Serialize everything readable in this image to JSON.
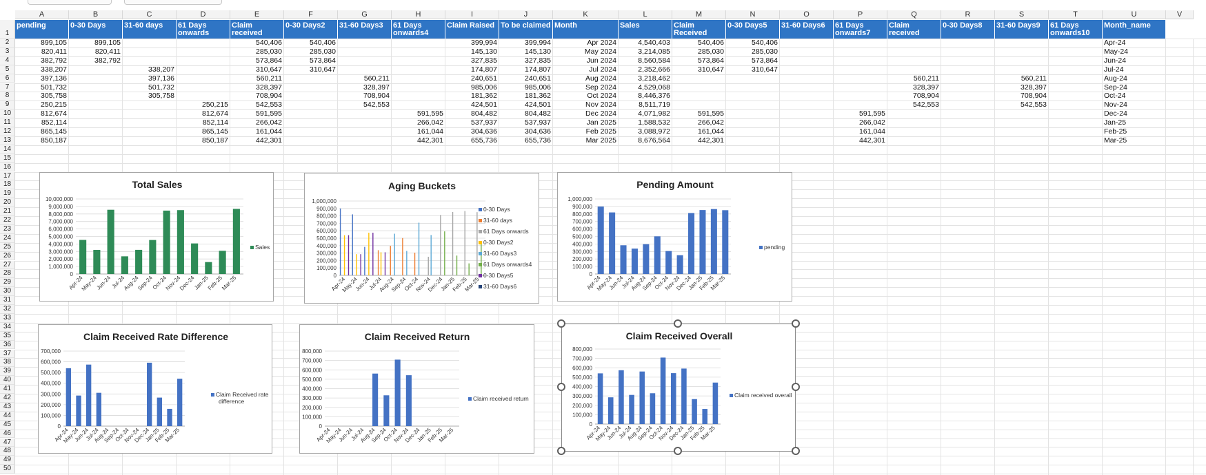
{
  "sheet": {
    "columns": [
      "A",
      "B",
      "C",
      "D",
      "E",
      "F",
      "G",
      "H",
      "I",
      "J",
      "K",
      "L",
      "M",
      "N",
      "O",
      "P",
      "Q",
      "R",
      "S",
      "T",
      "U",
      "V"
    ],
    "row_numbers": [
      "1",
      "2",
      "3",
      "4",
      "5",
      "6",
      "7",
      "8",
      "9",
      "10",
      "11",
      "12",
      "13",
      "14",
      "15",
      "16",
      "17",
      "18",
      "19",
      "20",
      "21",
      "22",
      "23",
      "24",
      "25",
      "26",
      "27",
      "28",
      "29",
      "30",
      "31",
      "32",
      "33",
      "34",
      "35",
      "36",
      "37",
      "38",
      "39",
      "40",
      "41",
      "42",
      "43",
      "44",
      "45",
      "46",
      "47",
      "48",
      "49",
      "50"
    ],
    "headers": [
      "pending",
      "0-30 Days",
      "31-60 days",
      "61 Days onwards",
      "Claim received",
      "0-30 Days2",
      "31-60 Days3",
      "61 Days onwards4",
      "Claim Raised",
      "To be claimed",
      "Month",
      "Sales",
      "Claim Received",
      "0-30 Days5",
      "31-60 Days6",
      "61 Days onwards7",
      "Claim received",
      "0-30 Days8",
      "31-60 Days9",
      "61 Days onwards10",
      "Month_name"
    ],
    "rows": [
      [
        "899,105",
        "899,105",
        "",
        "",
        "540,406",
        "540,406",
        "",
        "",
        "399,994",
        "399,994",
        "Apr 2024",
        "4,540,403",
        "540,406",
        "540,406",
        "",
        "",
        "",
        "",
        "",
        "",
        "Apr-24"
      ],
      [
        "820,411",
        "820,411",
        "",
        "",
        "285,030",
        "285,030",
        "",
        "",
        "145,130",
        "145,130",
        "May 2024",
        "3,214,085",
        "285,030",
        "285,030",
        "",
        "",
        "",
        "",
        "",
        "",
        "May-24"
      ],
      [
        "382,792",
        "382,792",
        "",
        "",
        "573,864",
        "573,864",
        "",
        "",
        "327,835",
        "327,835",
        "Jun 2024",
        "8,560,584",
        "573,864",
        "573,864",
        "",
        "",
        "",
        "",
        "",
        "",
        "Jun-24"
      ],
      [
        "338,207",
        "",
        "338,207",
        "",
        "310,647",
        "310,647",
        "",
        "",
        "174,807",
        "174,807",
        "Jul 2024",
        "2,352,666",
        "310,647",
        "310,647",
        "",
        "",
        "",
        "",
        "",
        "",
        "Jul-24"
      ],
      [
        "397,136",
        "",
        "397,136",
        "",
        "560,211",
        "",
        "560,211",
        "",
        "240,651",
        "240,651",
        "Aug 2024",
        "3,218,462",
        "",
        "",
        "",
        "",
        "560,211",
        "",
        "560,211",
        "",
        "Aug-24"
      ],
      [
        "501,732",
        "",
        "501,732",
        "",
        "328,397",
        "",
        "328,397",
        "",
        "985,006",
        "985,006",
        "Sep 2024",
        "4,529,068",
        "",
        "",
        "",
        "",
        "328,397",
        "",
        "328,397",
        "",
        "Sep-24"
      ],
      [
        "305,758",
        "",
        "305,758",
        "",
        "708,904",
        "",
        "708,904",
        "",
        "181,362",
        "181,362",
        "Oct 2024",
        "8,446,376",
        "",
        "",
        "",
        "",
        "708,904",
        "",
        "708,904",
        "",
        "Oct-24"
      ],
      [
        "250,215",
        "",
        "",
        "250,215",
        "542,553",
        "",
        "542,553",
        "",
        "424,501",
        "424,501",
        "Nov 2024",
        "8,511,719",
        "",
        "",
        "",
        "",
        "542,553",
        "",
        "542,553",
        "",
        "Nov-24"
      ],
      [
        "812,674",
        "",
        "",
        "812,674",
        "591,595",
        "",
        "",
        "591,595",
        "804,482",
        "804,482",
        "Dec 2024",
        "4,071,982",
        "591,595",
        "",
        "",
        "591,595",
        "",
        "",
        "",
        "",
        "Dec-24"
      ],
      [
        "852,114",
        "",
        "",
        "852,114",
        "266,042",
        "",
        "",
        "266,042",
        "537,937",
        "537,937",
        "Jan 2025",
        "1,588,532",
        "266,042",
        "",
        "",
        "266,042",
        "",
        "",
        "",
        "",
        "Jan-25"
      ],
      [
        "865,145",
        "",
        "",
        "865,145",
        "161,044",
        "",
        "",
        "161,044",
        "304,636",
        "304,636",
        "Feb 2025",
        "3,088,972",
        "161,044",
        "",
        "",
        "161,044",
        "",
        "",
        "",
        "",
        "Feb-25"
      ],
      [
        "850,187",
        "",
        "",
        "850,187",
        "442,301",
        "",
        "",
        "442,301",
        "655,736",
        "655,736",
        "Mar 2025",
        "8,676,564",
        "442,301",
        "",
        "",
        "442,301",
        "",
        "",
        "",
        "",
        "Mar-25"
      ]
    ]
  },
  "colors": {
    "header_bg": "#2f75c5",
    "green": "#2e8b57",
    "blue": "#4472c4"
  },
  "charts": [
    {
      "id": "total-sales",
      "title": "Total Sales",
      "legend": [
        "Sales"
      ],
      "colors": [
        "#2e8b57"
      ]
    },
    {
      "id": "aging-buckets",
      "title": "Aging Buckets",
      "legend": [
        "0-30 Days",
        "31-60 days",
        "61 Days onwards",
        "0-30 Days2",
        "31-60 Days3",
        "61 Days onwards4",
        "0-30 Days5",
        "31-60 Days6"
      ],
      "colors": [
        "#4472c4",
        "#ed7d31",
        "#a5a5a5",
        "#ffc000",
        "#5ba8d5",
        "#70ad47",
        "#7030a0",
        "#264478"
      ]
    },
    {
      "id": "pending-amount",
      "title": "Pending Amount",
      "legend": [
        "pending"
      ],
      "colors": [
        "#4472c4"
      ]
    },
    {
      "id": "claim-rate-diff",
      "title": "Claim Received Rate Difference",
      "legend": [
        "Claim Received rate",
        "difference"
      ],
      "colors": [
        "#4472c4"
      ]
    },
    {
      "id": "claim-return",
      "title": "Claim Received Return",
      "legend": [
        "Claim received return"
      ],
      "colors": [
        "#4472c4"
      ]
    },
    {
      "id": "claim-overall",
      "title": "Claim Received Overall",
      "legend": [
        "Claim received overall"
      ],
      "colors": [
        "#4472c4"
      ]
    }
  ],
  "chart_data": [
    {
      "type": "bar",
      "title": "Total Sales",
      "categories": [
        "Apr-24",
        "May-24",
        "Jun-24",
        "Jul-24",
        "Aug-24",
        "Sep-24",
        "Oct-24",
        "Nov-24",
        "Dec-24",
        "Jan-25",
        "Feb-25",
        "Mar-25"
      ],
      "series": [
        {
          "name": "Sales",
          "values": [
            4540403,
            3214085,
            8560584,
            2352666,
            3218462,
            4529068,
            8446376,
            8511719,
            4071982,
            1588532,
            3088972,
            8676564
          ]
        }
      ],
      "ylim": [
        0,
        10000000
      ],
      "yticks": [
        "0",
        "1,000,000",
        "2,000,000",
        "3,000,000",
        "4,000,000",
        "5,000,000",
        "6,000,000",
        "7,000,000",
        "8,000,000",
        "9,000,000",
        "10,000,000"
      ],
      "legend": "right"
    },
    {
      "type": "bar",
      "title": "Aging Buckets",
      "categories": [
        "Apr-24",
        "May-24",
        "Jun-24",
        "Jul-24",
        "Aug-24",
        "Sep-24",
        "Oct-24",
        "Nov-24",
        "Dec-24",
        "Jan-25",
        "Feb-25",
        "Mar-25"
      ],
      "series": [
        {
          "name": "0-30 Days",
          "values": [
            899105,
            820411,
            382792,
            0,
            0,
            0,
            0,
            0,
            0,
            0,
            0,
            0
          ]
        },
        {
          "name": "31-60 days",
          "values": [
            0,
            0,
            0,
            338207,
            397136,
            501732,
            305758,
            0,
            0,
            0,
            0,
            0
          ]
        },
        {
          "name": "61 Days onwards",
          "values": [
            0,
            0,
            0,
            0,
            0,
            0,
            0,
            250215,
            812674,
            852114,
            865145,
            850187
          ]
        },
        {
          "name": "0-30 Days2",
          "values": [
            540406,
            285030,
            573864,
            310647,
            0,
            0,
            0,
            0,
            0,
            0,
            0,
            0
          ]
        },
        {
          "name": "31-60 Days3",
          "values": [
            0,
            0,
            0,
            0,
            560211,
            328397,
            708904,
            542553,
            0,
            0,
            0,
            0
          ]
        },
        {
          "name": "61 Days onwards4",
          "values": [
            0,
            0,
            0,
            0,
            0,
            0,
            0,
            0,
            591595,
            266042,
            161044,
            442301
          ]
        },
        {
          "name": "0-30 Days5",
          "values": [
            540406,
            285030,
            573864,
            310647,
            0,
            0,
            0,
            0,
            0,
            0,
            0,
            0
          ]
        },
        {
          "name": "31-60 Days6",
          "values": [
            0,
            0,
            0,
            0,
            0,
            0,
            0,
            0,
            0,
            0,
            0,
            0
          ]
        }
      ],
      "ylim": [
        0,
        1000000
      ],
      "yticks": [
        "0",
        "100,000",
        "200,000",
        "300,000",
        "400,000",
        "500,000",
        "600,000",
        "700,000",
        "800,000",
        "900,000",
        "1,000,000"
      ],
      "legend": "right"
    },
    {
      "type": "bar",
      "title": "Pending Amount",
      "categories": [
        "Apr-24",
        "May-24",
        "Jun-24",
        "Jul-24",
        "Aug-24",
        "Sep-24",
        "Oct-24",
        "Nov-24",
        "Dec-24",
        "Jan-25",
        "Feb-25",
        "Mar-25"
      ],
      "series": [
        {
          "name": "pending",
          "values": [
            899105,
            820411,
            382792,
            338207,
            397136,
            501732,
            305758,
            250215,
            812674,
            852114,
            865145,
            850187
          ]
        }
      ],
      "ylim": [
        0,
        1000000
      ],
      "yticks": [
        "0",
        "100,000",
        "200,000",
        "300,000",
        "400,000",
        "500,000",
        "600,000",
        "700,000",
        "800,000",
        "900,000",
        "1,000,000"
      ],
      "legend": "right"
    },
    {
      "type": "bar",
      "title": "Claim Received Rate Difference",
      "categories": [
        "Apr-24",
        "May-24",
        "Jun-24",
        "Jul-24",
        "Aug-24",
        "Sep-24",
        "Oct-24",
        "Nov-24",
        "Dec-24",
        "Jan-25",
        "Feb-25",
        "Mar-25"
      ],
      "series": [
        {
          "name": "Claim Received rate difference",
          "values": [
            540406,
            285030,
            573864,
            310647,
            0,
            0,
            0,
            0,
            591595,
            266042,
            161044,
            442301
          ]
        }
      ],
      "ylim": [
        0,
        700000
      ],
      "yticks": [
        "0",
        "100,000",
        "200,000",
        "300,000",
        "400,000",
        "500,000",
        "600,000",
        "700,000"
      ],
      "legend": "right"
    },
    {
      "type": "bar",
      "title": "Claim Received Return",
      "categories": [
        "Apr-24",
        "May-24",
        "Jun-24",
        "Jul-24",
        "Aug-24",
        "Sep-24",
        "Oct-24",
        "Nov-24",
        "Dec-24",
        "Jan-25",
        "Feb-25",
        "Mar-25"
      ],
      "series": [
        {
          "name": "Claim received return",
          "values": [
            0,
            0,
            0,
            0,
            560211,
            328397,
            708904,
            542553,
            0,
            0,
            0,
            0
          ]
        }
      ],
      "ylim": [
        0,
        800000
      ],
      "yticks": [
        "0",
        "100,000",
        "200,000",
        "300,000",
        "400,000",
        "500,000",
        "600,000",
        "700,000",
        "800,000"
      ],
      "legend": "right"
    },
    {
      "type": "bar",
      "title": "Claim Received Overall",
      "categories": [
        "Apr-24",
        "May-24",
        "Jun-24",
        "Jul-24",
        "Aug-24",
        "Sep-24",
        "Oct-24",
        "Nov-24",
        "Dec-24",
        "Jan-25",
        "Feb-25",
        "Mar-25"
      ],
      "series": [
        {
          "name": "Claim received overall",
          "values": [
            540406,
            285030,
            573864,
            310647,
            560211,
            328397,
            708904,
            542553,
            591595,
            266042,
            161044,
            442301
          ]
        }
      ],
      "ylim": [
        0,
        800000
      ],
      "yticks": [
        "0",
        "100,000",
        "200,000",
        "300,000",
        "400,000",
        "500,000",
        "600,000",
        "700,000",
        "800,000"
      ],
      "legend": "right"
    }
  ]
}
